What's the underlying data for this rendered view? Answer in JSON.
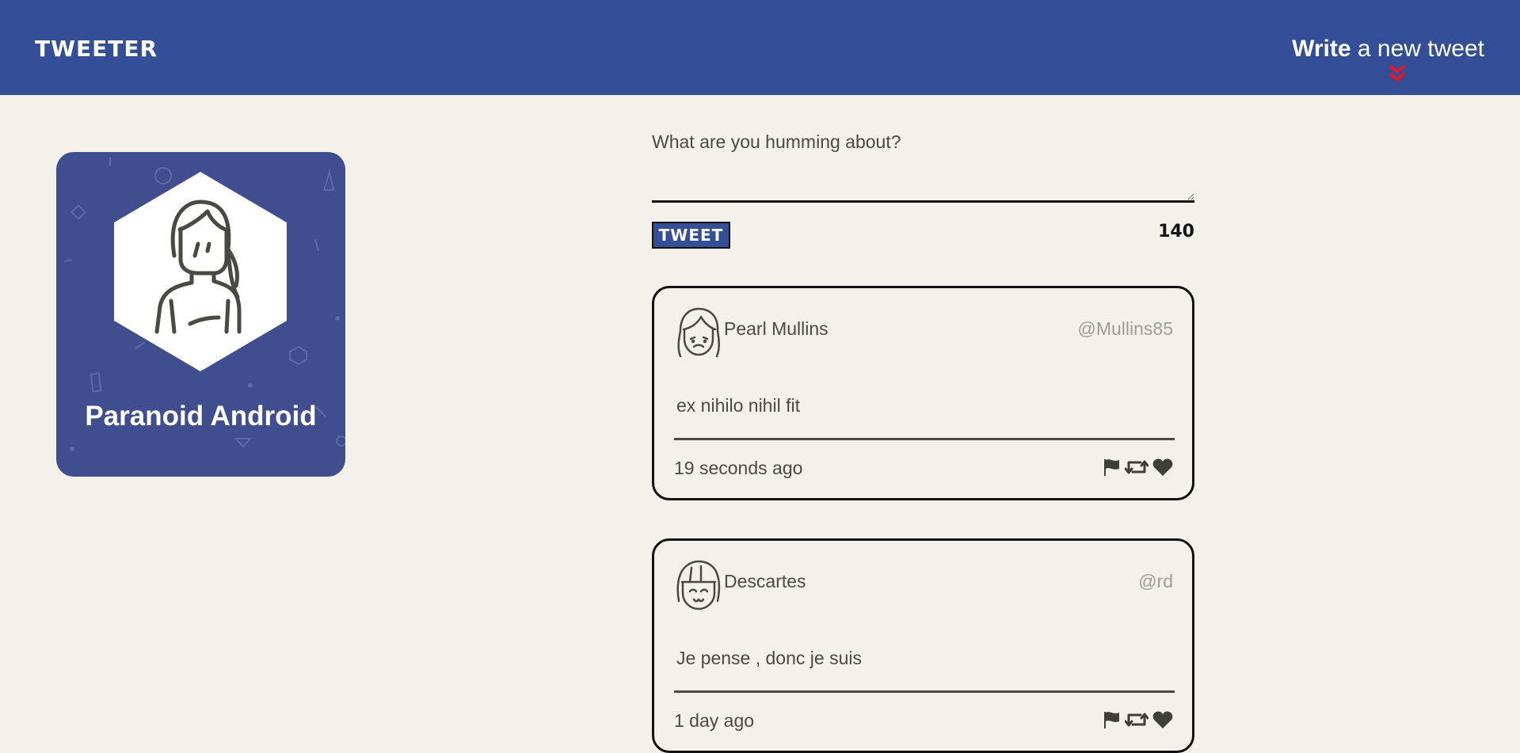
{
  "nav": {
    "brand": "TWEETER",
    "compose_bold": "Write",
    "compose_rest": " a new tweet",
    "accent_color": "#e0182a",
    "bg_color": "#344e98"
  },
  "profile": {
    "name": "Paranoid Android",
    "avatar_icon": "person-with-long-hair-icon",
    "card_color": "#404e90"
  },
  "composer": {
    "placeholder": "What are you humming about?",
    "button_label": "TWEET",
    "counter": "140"
  },
  "tweets": [
    {
      "author": "Pearl Mullins",
      "handle": "@Mullins85",
      "body": "ex nihilo nihil fit",
      "time": "19 seconds ago",
      "avatar_icon": "sad-girl-avatar-icon"
    },
    {
      "author": "Descartes",
      "handle": "@rd",
      "body": "Je pense , donc je suis",
      "time": "1 day ago",
      "avatar_icon": "smiling-girl-avatar-icon"
    }
  ],
  "actions": [
    "flag-icon",
    "retweet-icon",
    "heart-icon"
  ]
}
